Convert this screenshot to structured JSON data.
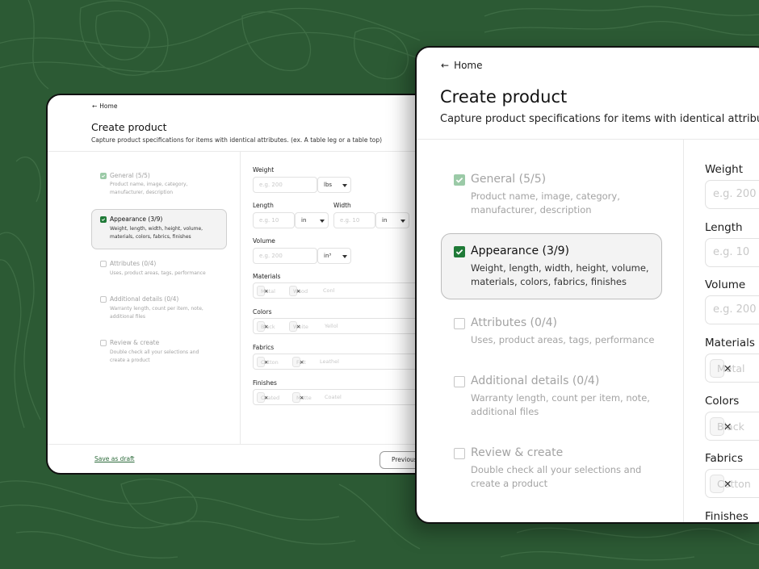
{
  "colors": {
    "background": "#2c5a34",
    "accent": "#1f7a37",
    "accent_light": "#9bcaa7"
  },
  "icons": {
    "back": "arrow-left-icon",
    "check": "check-icon",
    "remove": "x-icon",
    "dropdown": "chevron-down-icon"
  },
  "nav": {
    "home_label": "Home"
  },
  "header": {
    "title": "Create product",
    "subtitle_back": "Capture product specifications for items with identical attributes. (ex. A table leg or a table top)",
    "subtitle_front": "Capture product specifications for items with identical attribut"
  },
  "steps": [
    {
      "title": "General (5/5)",
      "desc_lines": [
        "Product name, image, category,",
        "manufacturer, description"
      ],
      "state": "complete"
    },
    {
      "title": "Appearance (3/9)",
      "desc_lines": [
        "Weight, length, width, height, volume,",
        "materials, colors, fabrics, finishes"
      ],
      "state": "active"
    },
    {
      "title": "Attributes (0/4)",
      "desc_lines": [
        "Uses, product areas, tags, performance"
      ],
      "state": "pending"
    },
    {
      "title": "Additional details (0/4)",
      "desc_lines": [
        "Warranty length, count per item, note,",
        "additional files"
      ],
      "state": "pending"
    },
    {
      "title": "Review & create",
      "desc_lines": [
        "Double check all your selections and",
        "create a product"
      ],
      "state": "pending"
    }
  ],
  "form": {
    "weight": {
      "label": "Weight",
      "placeholder": "e.g. 200",
      "unit": "lbs"
    },
    "length": {
      "label": "Length",
      "placeholder": "e.g. 10",
      "unit": "in"
    },
    "width": {
      "label": "Width",
      "placeholder": "e.g. 10",
      "unit": "in"
    },
    "volume": {
      "label": "Volume",
      "placeholder": "e.g. 200",
      "unit": "in³"
    },
    "materials": {
      "label": "Materials",
      "tags": [
        "Metal",
        "Wood"
      ],
      "placeholder": "Conl"
    },
    "colors": {
      "label": "Colors",
      "tags": [
        "Black",
        "White"
      ],
      "placeholder": "Yellol"
    },
    "fabrics": {
      "label": "Fabrics",
      "tags": [
        "Cotton",
        "Felt"
      ],
      "placeholder": "Leathel"
    },
    "finishes": {
      "label": "Finishes",
      "tags": [
        "Coated",
        "Matte"
      ],
      "placeholder": "Coatel"
    }
  },
  "footer": {
    "save_draft": "Save as draft",
    "previous": "Previous"
  }
}
